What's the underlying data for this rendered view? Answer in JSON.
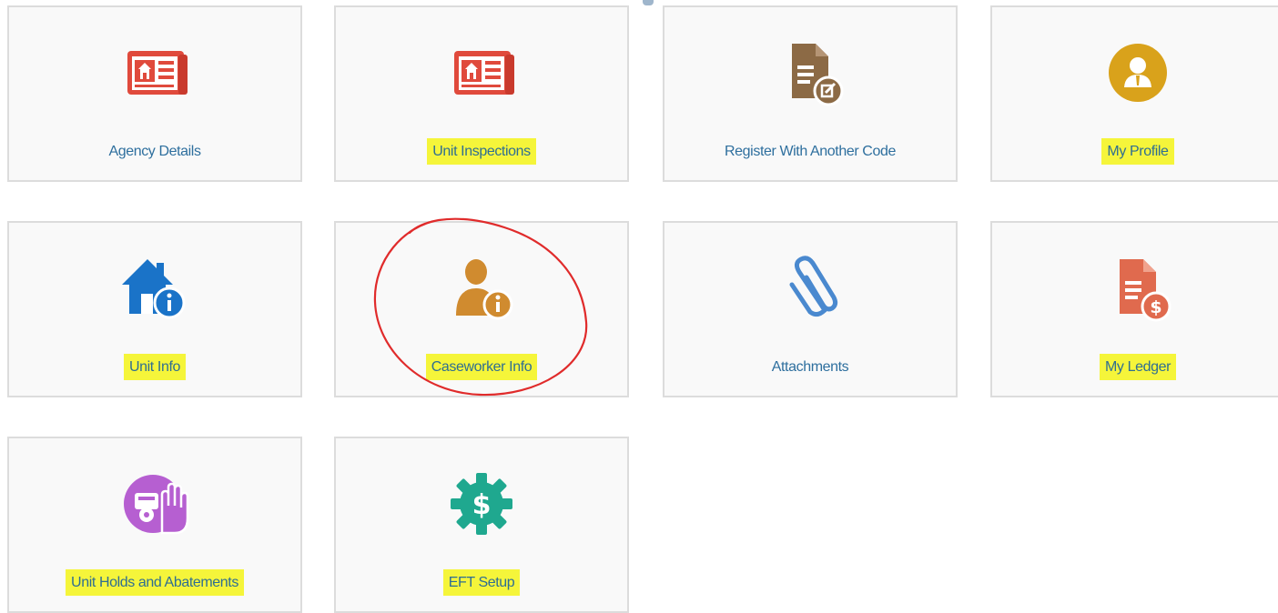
{
  "tiles": [
    {
      "label": "Agency Details",
      "icon": "newspaper-home-icon",
      "highlighted": false,
      "color": "#e04a3c"
    },
    {
      "label": "Unit Inspections",
      "icon": "newspaper-home-icon",
      "highlighted": true,
      "color": "#e04a3c"
    },
    {
      "label": "Register With Another Code",
      "icon": "document-edit-icon",
      "highlighted": false,
      "color": "#8c6a45"
    },
    {
      "label": "My Profile",
      "icon": "user-profile-icon",
      "highlighted": true,
      "color": "#d9a21b"
    },
    {
      "label": "Unit Info",
      "icon": "house-info-icon",
      "highlighted": true,
      "color": "#1a73c8"
    },
    {
      "label": "Caseworker Info",
      "icon": "person-info-icon",
      "highlighted": true,
      "color": "#d08b2f"
    },
    {
      "label": "Attachments",
      "icon": "paperclip-icon",
      "highlighted": false,
      "color": "#4a89cf"
    },
    {
      "label": "My Ledger",
      "icon": "document-dollar-icon",
      "highlighted": true,
      "color": "#e06a4e"
    },
    {
      "label": "Unit Holds and Abatements",
      "icon": "hold-hand-icon",
      "highlighted": true,
      "color": "#b65fd1"
    },
    {
      "label": "EFT Setup",
      "icon": "gear-dollar-icon",
      "highlighted": true,
      "color": "#1fa88f"
    }
  ],
  "annotations": {
    "circled_tile": "Caseworker Info",
    "circle_color": "#e02b2b",
    "highlight_color": "#f5f53a"
  }
}
